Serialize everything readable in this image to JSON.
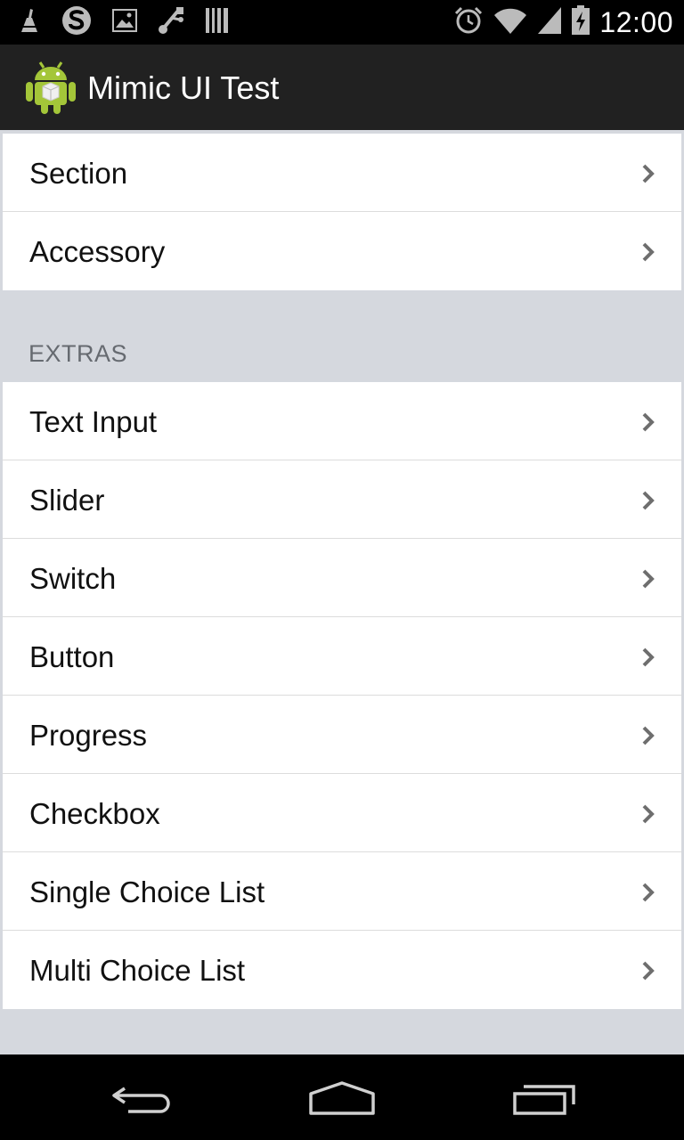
{
  "status_bar": {
    "time": "12:00",
    "left_icons": [
      "cleaner-icon",
      "swype-icon",
      "gallery-icon",
      "usb-debug-icon",
      "barcode-icon"
    ],
    "right_icons": [
      "alarm-icon",
      "wifi-icon",
      "signal-icon",
      "battery-charging-icon"
    ]
  },
  "action_bar": {
    "title": "Mimic UI Test",
    "icon": "android-logo-icon"
  },
  "groups": [
    {
      "header": "",
      "items": [
        {
          "label": "Section"
        },
        {
          "label": "Accessory"
        }
      ]
    },
    {
      "header": "EXTRAS",
      "items": [
        {
          "label": "Text Input"
        },
        {
          "label": "Slider"
        },
        {
          "label": "Switch"
        },
        {
          "label": "Button"
        },
        {
          "label": "Progress"
        },
        {
          "label": "Checkbox"
        },
        {
          "label": "Single Choice List"
        },
        {
          "label": "Multi Choice List"
        }
      ]
    }
  ],
  "nav_bar": {
    "buttons": [
      "back-icon",
      "home-icon",
      "recents-icon"
    ]
  },
  "colors": {
    "status_bar": "#000000",
    "action_bar": "#212121",
    "background": "#d5d8de",
    "row_background": "#ffffff",
    "header_text": "#666a70",
    "chevron": "#6e6e6e"
  }
}
